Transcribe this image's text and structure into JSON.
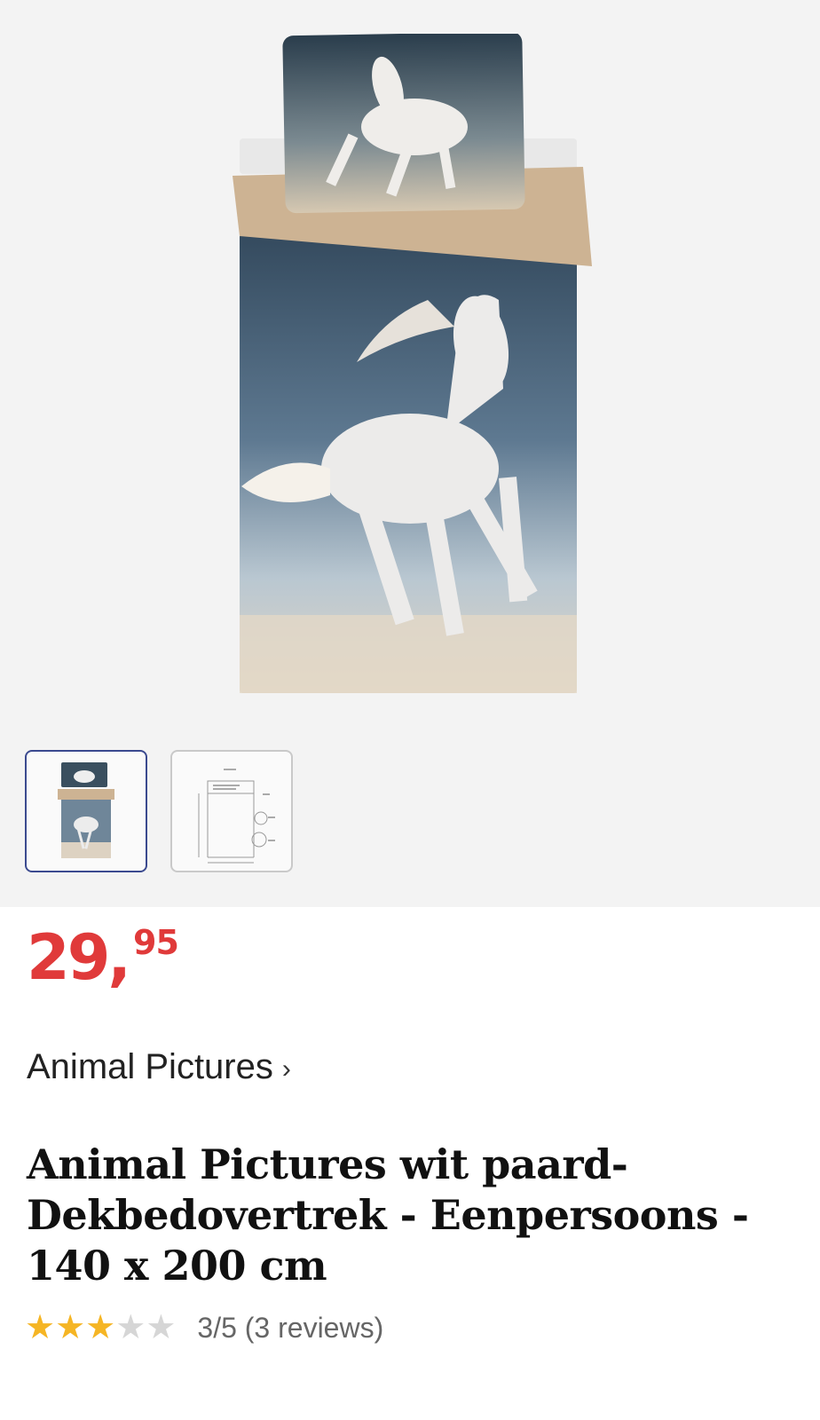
{
  "product": {
    "price": {
      "whole": "29",
      "comma": ",",
      "cents": "95"
    },
    "brand": "Animal Pictures",
    "brand_chevron": "›",
    "title": "Animal Pictures wit paard- Dekbedovertrek - Eenpersoons - 140 x 200 cm",
    "rating": {
      "score": 3,
      "max": 5,
      "text": "3/5 (3 reviews)"
    }
  },
  "gallery": {
    "main_image": "white-horse-duvet-cover",
    "thumbnails": [
      {
        "name": "thumb-duvet-photo",
        "active": true
      },
      {
        "name": "thumb-dimension-drawing",
        "active": false
      }
    ]
  },
  "colors": {
    "price": "#e03a3a",
    "star_on": "#f5b524",
    "star_off": "#d6d6d6",
    "thumb_active": "#3b4a8f"
  }
}
